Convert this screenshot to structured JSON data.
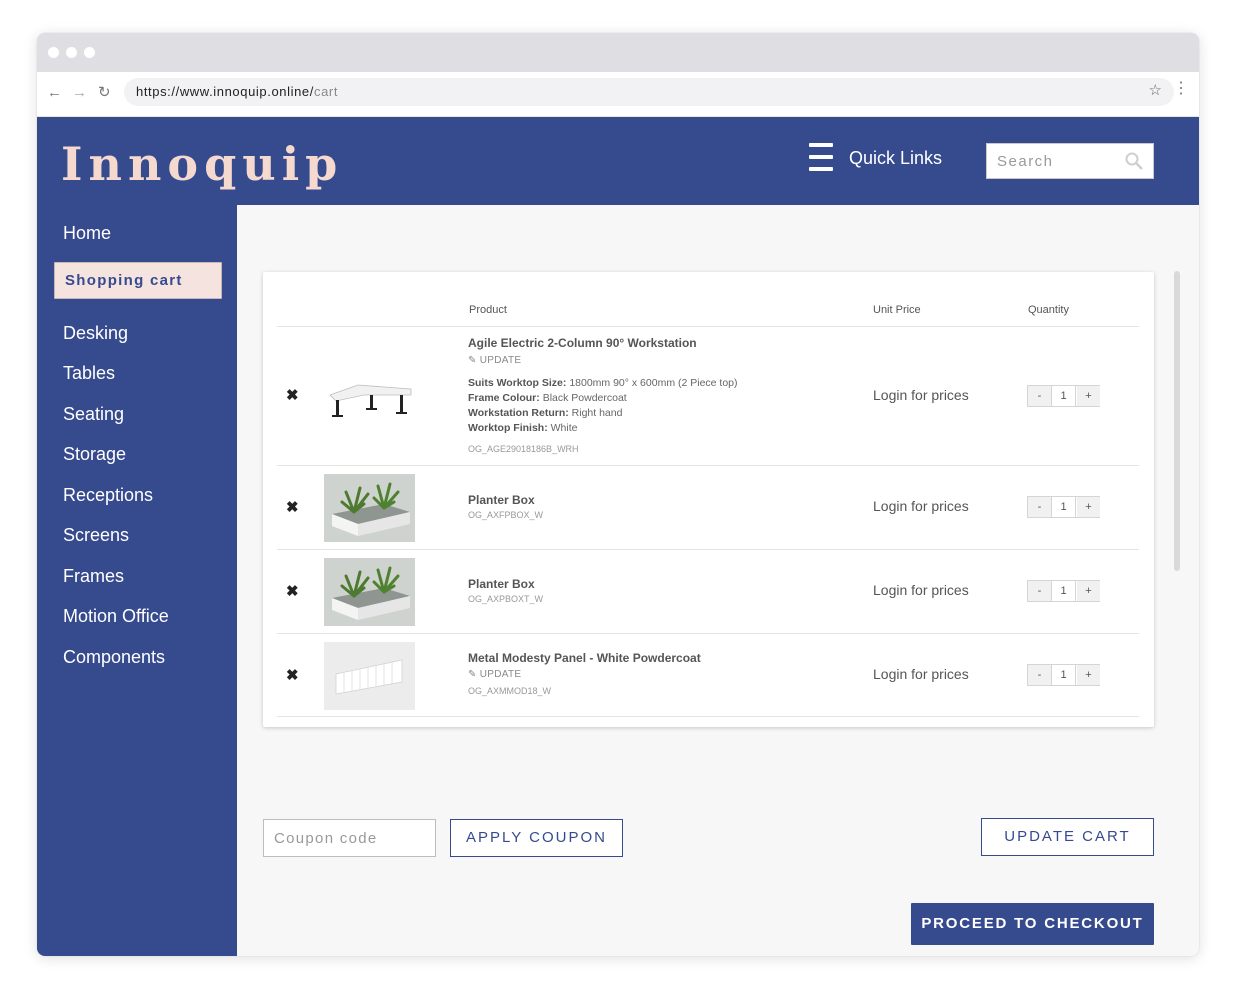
{
  "browser": {
    "url_host": "https://www.innoquip.online/",
    "url_path": "cart"
  },
  "header": {
    "logo": "Innoquip",
    "quick_links": "Quick Links",
    "search_placeholder": "Search"
  },
  "sidebar": {
    "items": [
      {
        "label": "Home"
      },
      {
        "label": "Shopping cart"
      },
      {
        "label": "Desking"
      },
      {
        "label": "Tables"
      },
      {
        "label": "Seating"
      },
      {
        "label": "Storage"
      },
      {
        "label": "Receptions"
      },
      {
        "label": "Screens"
      },
      {
        "label": "Frames"
      },
      {
        "label": "Motion Office"
      },
      {
        "label": "Components"
      }
    ]
  },
  "cart": {
    "columns": {
      "product": "Product",
      "unit_price": "Unit Price",
      "quantity": "Quantity"
    },
    "remove_symbol": "✖",
    "update_label": "UPDATE",
    "items": [
      {
        "name": "Agile Electric 2-Column 90° Workstation",
        "attributes": [
          {
            "key": "Suits Worktop Size:",
            "value": "1800mm 90° x 600mm (2 Piece top)"
          },
          {
            "key": "Frame Colour:",
            "value": "Black Powdercoat"
          },
          {
            "key": "Workstation Return:",
            "value": "Right hand"
          },
          {
            "key": "Worktop Finish:",
            "value": "White"
          }
        ],
        "sku": "OG_AGE29018186B_WRH",
        "price": "Login for prices",
        "qty": "1"
      },
      {
        "name": "Planter Box",
        "sku": "OG_AXFPBOX_W",
        "price": "Login for prices",
        "qty": "1"
      },
      {
        "name": "Planter Box",
        "sku": "OG_AXPBOXT_W",
        "price": "Login for prices",
        "qty": "1"
      },
      {
        "name": "Metal Modesty Panel - White Powdercoat",
        "sku": "OG_AXMMOD18_W",
        "price": "Login for prices",
        "qty": "1"
      }
    ],
    "qty_minus": "-",
    "qty_plus": "+"
  },
  "actions": {
    "coupon_placeholder": "Coupon code",
    "apply_coupon": "APPLY COUPON",
    "update_cart": "UPDATE CART",
    "checkout": "PROCEED TO CHECKOUT"
  },
  "colors": {
    "brand": "#364a8e",
    "accent": "#f5e3df"
  }
}
